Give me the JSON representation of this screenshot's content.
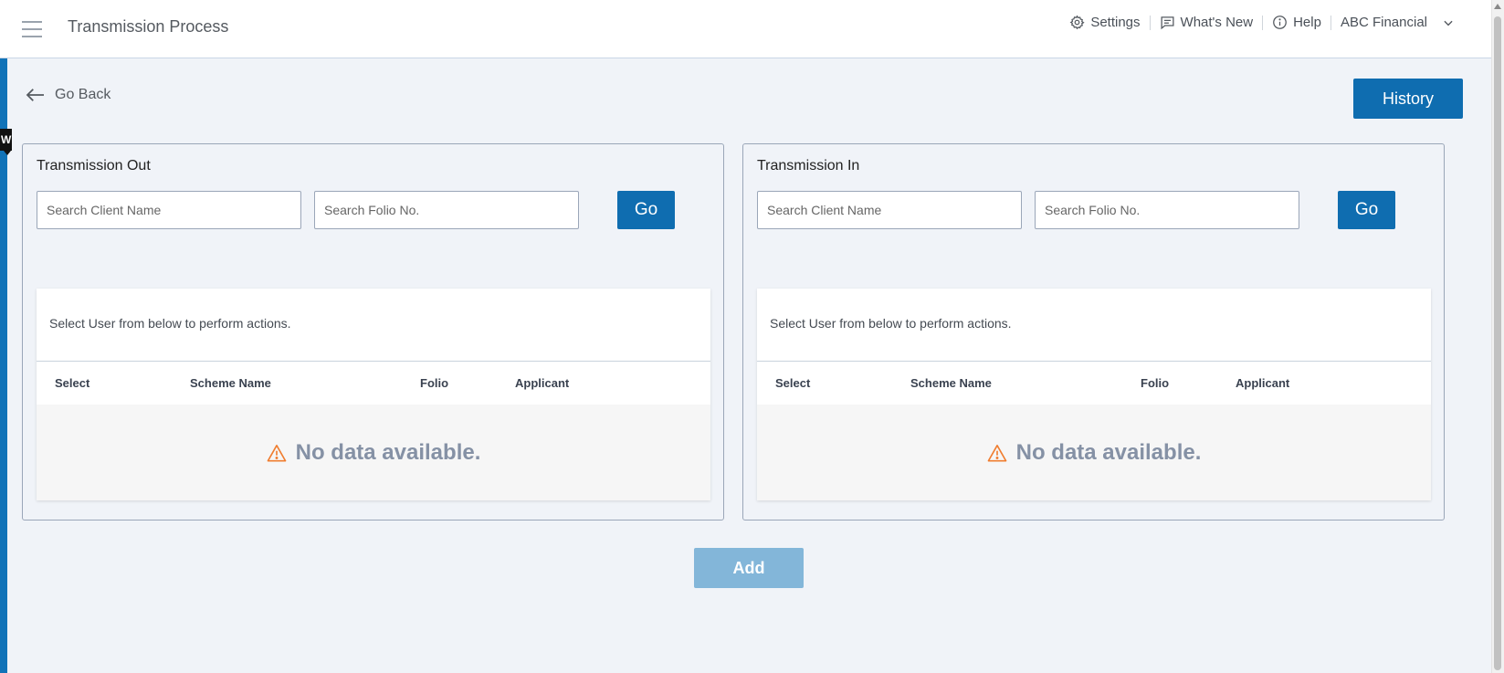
{
  "header": {
    "title": "Transmission Process",
    "nav": {
      "settings": "Settings",
      "whats_new": "What's New",
      "help": "Help",
      "account": "ABC Financial"
    }
  },
  "go_back_label": "Go Back",
  "history_label": "History",
  "badge_letter": "W",
  "panels": {
    "out": {
      "title": "Transmission Out",
      "client_placeholder": "Search Client Name",
      "folio_placeholder": "Search Folio No.",
      "go_label": "Go",
      "caption": "Select User from below to perform actions.",
      "columns": [
        "Select",
        "Scheme Name",
        "Folio",
        "Applicant"
      ],
      "empty_message": "No data available."
    },
    "in": {
      "title": "Transmission In",
      "client_placeholder": "Search Client Name",
      "folio_placeholder": "Search Folio No.",
      "go_label": "Go",
      "caption": "Select User from below to perform actions.",
      "columns": [
        "Select",
        "Scheme Name",
        "Folio",
        "Applicant"
      ],
      "empty_message": "No data available."
    }
  },
  "add_label": "Add",
  "colors": {
    "primary": "#0f6db0",
    "primary_disabled": "#83b6d9",
    "warning": "#f07d2f",
    "accent_strip": "#1173b8"
  }
}
